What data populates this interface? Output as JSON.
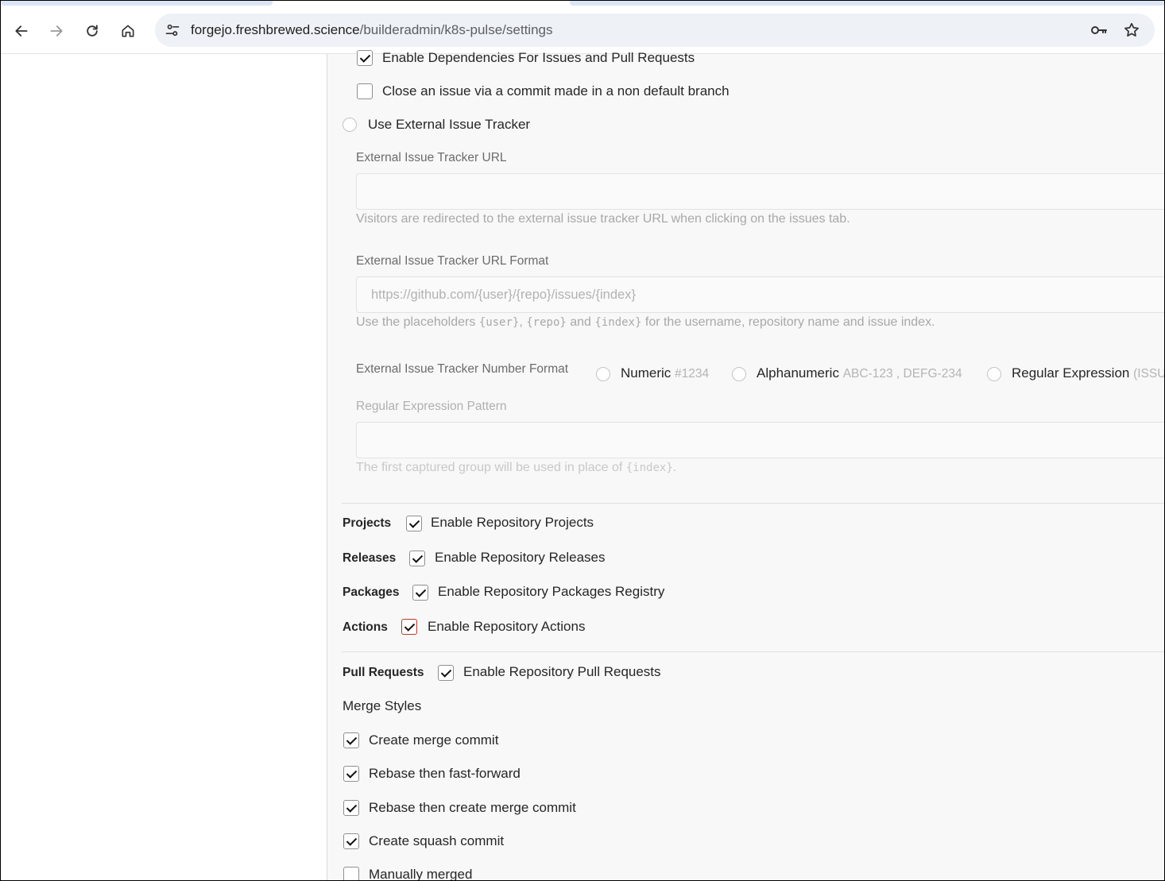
{
  "browser": {
    "url_host": "forgejo.freshbrewed.science",
    "url_path": "/builderadmin/k8s-pulse/settings"
  },
  "issues": {
    "dependencies_label": "Enable Dependencies For Issues and Pull Requests",
    "dependencies_checked": true,
    "close_commit_label": "Close an issue via a commit made in a non default branch",
    "close_commit_checked": false,
    "external_tracker_label": "Use External Issue Tracker",
    "tracker_url_label": "External Issue Tracker URL",
    "tracker_url_value": "",
    "tracker_url_help": "Visitors are redirected to the external issue tracker URL when clicking on the issues tab.",
    "url_format_label": "External Issue Tracker URL Format",
    "url_format_placeholder": "https://github.com/{user}/{repo}/issues/{index}",
    "url_format_help": {
      "prefix": "Use the placeholders ",
      "code1": "{user}",
      "sep1": ", ",
      "code2": "{repo}",
      "sep2": " and ",
      "code3": "{index}",
      "suffix": " for the username, repository name and issue index."
    },
    "number_format_label": "External Issue Tracker Number Format",
    "number_formats": [
      {
        "name": "Numeric",
        "example": "#1234"
      },
      {
        "name": "Alphanumeric",
        "example": "ABC-123 , DEFG-234"
      },
      {
        "name": "Regular Expression",
        "example": "(ISSU"
      }
    ],
    "regex_label": "Regular Expression Pattern",
    "regex_value": "",
    "regex_help": {
      "prefix": "The first captured group will be used in place of ",
      "code": "{index}",
      "suffix": "."
    }
  },
  "units": [
    {
      "name": "Projects",
      "label": "Enable Repository Projects",
      "checked": true
    },
    {
      "name": "Releases",
      "label": "Enable Repository Releases",
      "checked": true
    },
    {
      "name": "Packages",
      "label": "Enable Repository Packages Registry",
      "checked": true
    },
    {
      "name": "Actions",
      "label": "Enable Repository Actions",
      "checked": true
    }
  ],
  "pull_requests": {
    "name": "Pull Requests",
    "label": "Enable Repository Pull Requests",
    "checked": true,
    "merge_styles_title": "Merge Styles",
    "styles": [
      {
        "label": "Create merge commit",
        "checked": true
      },
      {
        "label": "Rebase then fast-forward",
        "checked": true
      },
      {
        "label": "Rebase then create merge commit",
        "checked": true
      },
      {
        "label": "Create squash commit",
        "checked": true
      },
      {
        "label": "Manually merged",
        "checked": false
      }
    ]
  }
}
